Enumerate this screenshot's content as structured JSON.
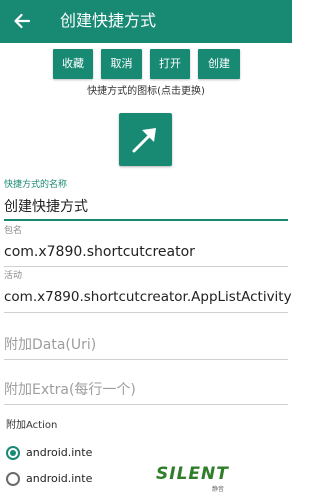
{
  "appbar": {
    "title": "创建快捷方式"
  },
  "buttons": {
    "favorite": "收藏",
    "cancel": "取消",
    "open": "打开",
    "create": "创建"
  },
  "icon_hint": "快捷方式的图标(点击更换)",
  "fields": {
    "name": {
      "label": "快捷方式的名称",
      "value": "创建快捷方式"
    },
    "package": {
      "label": "包名",
      "value": "com.x7890.shortcutcreator"
    },
    "activity": {
      "label": "活动",
      "value": "com.x7890.shortcutcreator.AppListActivity"
    },
    "data": {
      "placeholder": "附加Data(Uri)"
    },
    "extra": {
      "placeholder": "附加Extra(每行一个)"
    }
  },
  "action": {
    "label": "附加Action",
    "options": [
      "android.intent",
      "android.inten"
    ]
  },
  "watermark": {
    "brand": "SILENT",
    "sub": "静音"
  },
  "colors": {
    "accent": "#188a74",
    "appbar": "#188a74"
  }
}
